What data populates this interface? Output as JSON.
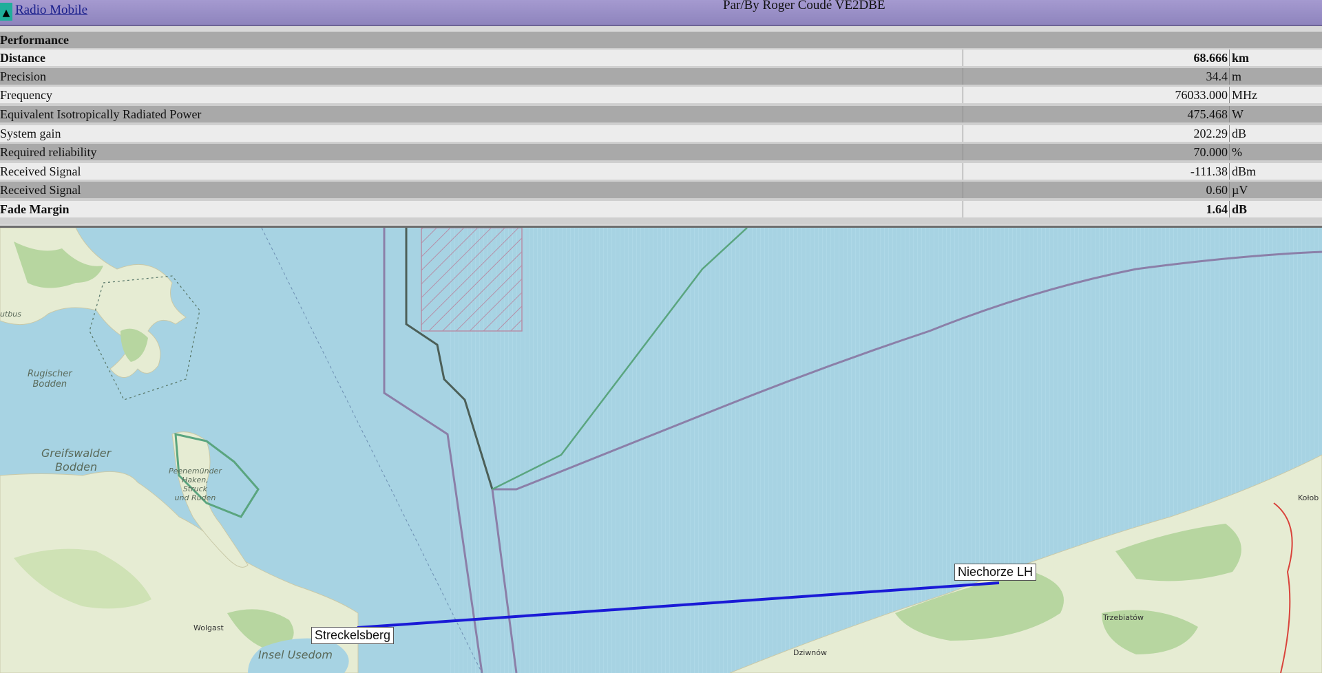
{
  "app": {
    "link_label": "Radio Mobile",
    "window_title": "Par/By Roger Coudé VE2DBE"
  },
  "table": {
    "header": "Performance",
    "rows": [
      {
        "label": "Distance",
        "value": "68.666",
        "unit": "km",
        "bold": true
      },
      {
        "label": "Precision",
        "value": "34.4",
        "unit": "m"
      },
      {
        "label": "Frequency",
        "value": "76033.000",
        "unit": "MHz"
      },
      {
        "label": "Equivalent Isotropically Radiated Power",
        "value": "475.468",
        "unit": "W"
      },
      {
        "label": "System gain",
        "value": "202.29",
        "unit": "dB"
      },
      {
        "label": "Required reliability",
        "value": "70.000",
        "unit": "%"
      },
      {
        "label": "Received Signal",
        "value": "-111.38",
        "unit": "dBm"
      },
      {
        "label": "Received Signal",
        "value": "0.60",
        "unit": "µV"
      },
      {
        "label": "Fade Margin",
        "value": "1.64",
        "unit": "dB",
        "bold": true
      }
    ]
  },
  "map": {
    "sea_color": "#a7d3e3",
    "land_color": "#e6ecd3",
    "forest_color": "#b7d6a0",
    "link_color": "#1a1ad6",
    "place_labels": {
      "putbus": "utbus",
      "rugischer": "Rugischer\nBodden",
      "greifswalder": "Greifswalder\nBodden",
      "peenemunder": "Peenemünder\nHaken,\nStruck\nund Ruden",
      "wolgast": "Wolgast",
      "usedom": "Insel Usedom",
      "dziwnow": "Dziwnów",
      "trzebiatow": "Trzebiatów",
      "kolobrzeg": "Kołob"
    },
    "sites": {
      "a": "Streckelsberg",
      "b": "Niechorze LH"
    }
  }
}
